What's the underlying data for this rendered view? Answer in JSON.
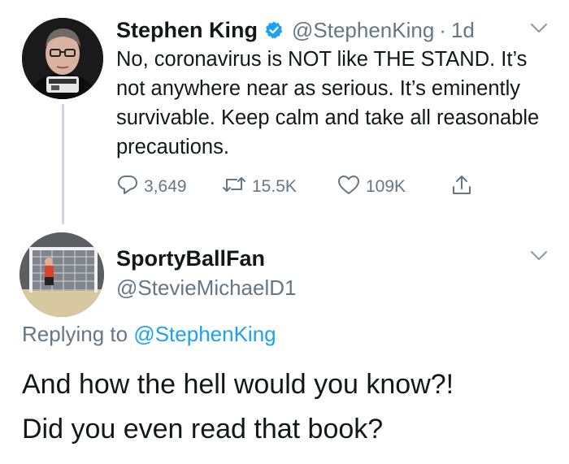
{
  "original_tweet": {
    "author_name": "Stephen King",
    "handle": "@StephenKing",
    "separator": "·",
    "time": "1d",
    "text": "No, coronavirus is NOT like THE STAND. It’s not anywhere near as serious. It’s eminently survivable. Keep calm and take all reasonable precautions.",
    "replies": "3,649",
    "retweets": "15.5K",
    "likes": "109K"
  },
  "reply_tweet": {
    "author_name": "SportyBallFan",
    "handle": "@StevieMichaelD1",
    "replying_prefix": "Replying to",
    "replying_to": "@StephenKing",
    "text_line1": "And how the hell would you know?!",
    "text_line2": "Did you even read that book?"
  },
  "colors": {
    "primary_text": "#14171a",
    "secondary_text": "#657786",
    "link_blue": "#1da1f2",
    "thread_line": "#ccd6dd"
  },
  "icons": [
    "verified-badge-icon",
    "chevron-down-icon",
    "reply-icon",
    "retweet-icon",
    "like-icon",
    "share-icon"
  ]
}
